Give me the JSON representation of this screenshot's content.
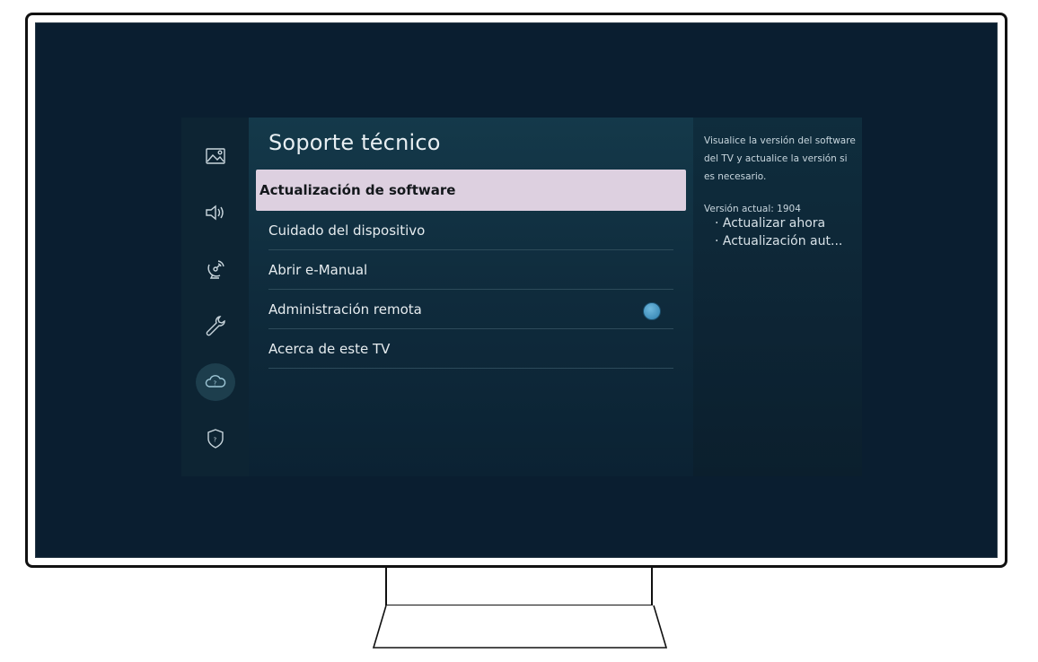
{
  "menu": {
    "title": "Soporte técnico",
    "rail_icons": [
      "picture-icon",
      "sound-icon",
      "broadcast-icon",
      "wrench-icon",
      "support-cloud-icon",
      "shield-icon"
    ],
    "items": [
      {
        "label": "Actualización de software",
        "selected": true
      },
      {
        "label": "Cuidado del dispositivo"
      },
      {
        "label": "Abrir e-Manual"
      },
      {
        "label": "Administración remota",
        "toggle": true
      },
      {
        "label": "Acerca de este TV"
      }
    ]
  },
  "info": {
    "description": "Visualice la versión del software del TV y actualice la versión si es necesario.",
    "version": "Versión actual: 1904",
    "options": [
      "· Actualizar ahora",
      "· Actualización aut..."
    ]
  },
  "colors": {
    "selected_bg": "#ddd0e0",
    "toggle_on": "#4a9fcf",
    "screen_bg": "#0a1e30"
  }
}
